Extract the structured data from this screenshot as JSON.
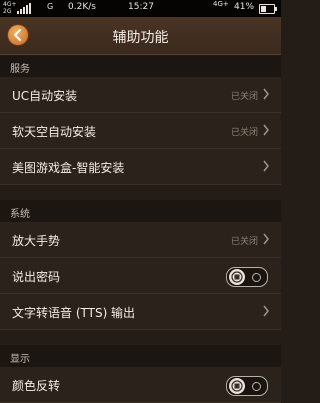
{
  "status_bar": {
    "net_a": "4G+",
    "net_b": "2G",
    "g": "G",
    "speed": "0.2K/s",
    "time": "15:27",
    "net_right": "4G+",
    "battery": "41%",
    "battery_level": 0.41
  },
  "header": {
    "title": "辅助功能",
    "back_icon": "chevron-left-icon"
  },
  "sections": {
    "services": {
      "title": "服务",
      "items": [
        {
          "label": "UC自动安装",
          "value": "已关闭"
        },
        {
          "label": "软天空自动安装",
          "value": "已关闭"
        },
        {
          "label": "美图游戏盒-智能安装",
          "value": ""
        }
      ]
    },
    "system": {
      "title": "系统",
      "items": [
        {
          "label": "放大手势",
          "value": "已关闭"
        },
        {
          "label": "说出密码",
          "toggle": "off"
        },
        {
          "label": "文字转语音 (TTS) 输出",
          "value": ""
        }
      ]
    },
    "display": {
      "title": "显示",
      "items": [
        {
          "label": "颜色反转",
          "toggle": "off"
        }
      ]
    }
  },
  "colors": {
    "accent": "#d98a3c",
    "background": "#241c16",
    "row": "#2b221b"
  }
}
